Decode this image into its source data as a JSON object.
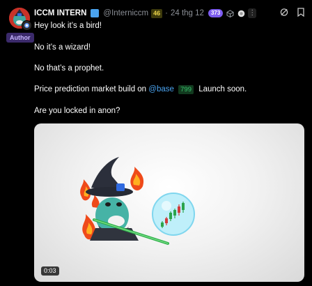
{
  "post": {
    "author_name": "ICCM INTERN",
    "handle": "@Interniccm",
    "handle_score": "46",
    "separator": "·",
    "date": "24 thg 12",
    "reach_badge": "373",
    "author_label": "Author",
    "icons": [
      "verified-icon",
      "cube-icon",
      "circle-icon",
      "refresh-icon",
      "more-icon",
      "grok-icon",
      "bookmark-icon"
    ],
    "lines": [
      "Hey look it’s a bird!",
      "No it’s a wizard!",
      "No that’s a prophet."
    ],
    "promo": {
      "before": "Price prediction market build on",
      "mention": "@base",
      "mention_count": "799",
      "after": "Launch soon."
    },
    "question": "Are you locked in anon?",
    "media": {
      "duration": "0:03"
    }
  },
  "colors": {
    "background": "#000000",
    "accent_blue": "#4aa3ef",
    "author_purple": "#3b2a6b",
    "badge_purple": "#7d5cf0"
  }
}
